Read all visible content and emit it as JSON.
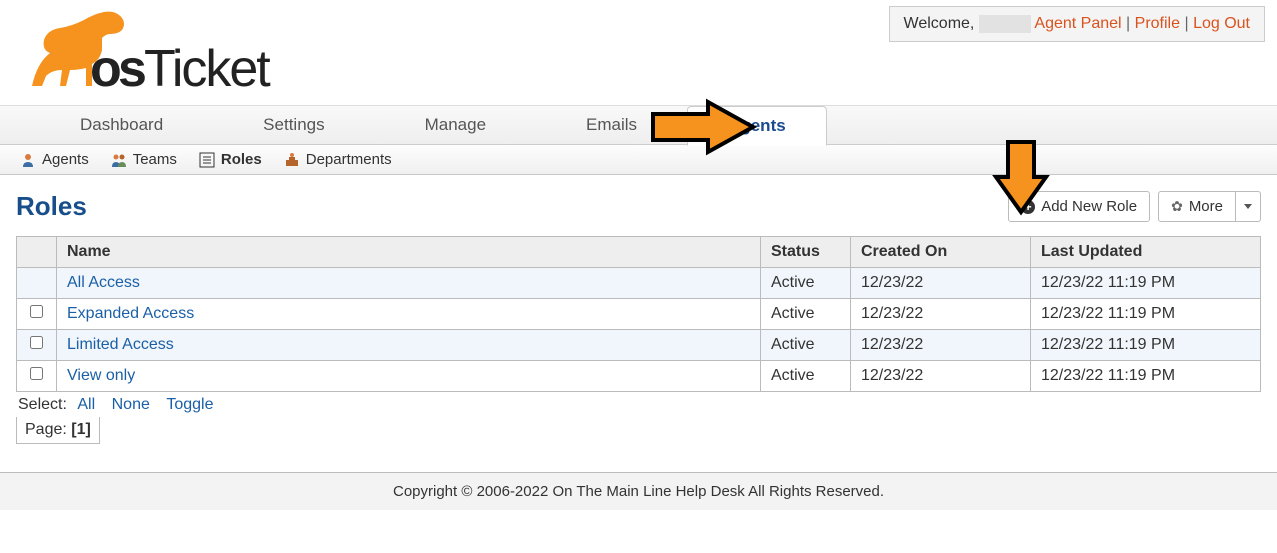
{
  "header": {
    "welcome": "Welcome,",
    "links": {
      "agent_panel": "Agent Panel",
      "profile": "Profile",
      "logout": "Log Out"
    }
  },
  "main_nav": {
    "items": [
      "Dashboard",
      "Settings",
      "Manage",
      "Emails",
      "Agents"
    ],
    "active_index": 4
  },
  "sub_nav": {
    "items": [
      {
        "label": "Agents",
        "icon": "agent-icon"
      },
      {
        "label": "Teams",
        "icon": "team-icon"
      },
      {
        "label": "Roles",
        "icon": "list-icon"
      },
      {
        "label": "Departments",
        "icon": "dept-icon"
      }
    ],
    "active_index": 2
  },
  "page": {
    "title": "Roles",
    "add_btn": "Add New Role",
    "more_btn": "More"
  },
  "table": {
    "headers": [
      "",
      "Name",
      "Status",
      "Created On",
      "Last Updated"
    ],
    "rows": [
      {
        "name": "All Access",
        "status": "Active",
        "created": "12/23/22",
        "updated": "12/23/22 11:19 PM",
        "checkbox": false
      },
      {
        "name": "Expanded Access",
        "status": "Active",
        "created": "12/23/22",
        "updated": "12/23/22 11:19 PM",
        "checkbox": true
      },
      {
        "name": "Limited Access",
        "status": "Active",
        "created": "12/23/22",
        "updated": "12/23/22 11:19 PM",
        "checkbox": true
      },
      {
        "name": "View only",
        "status": "Active",
        "created": "12/23/22",
        "updated": "12/23/22 11:19 PM",
        "checkbox": true
      }
    ]
  },
  "select_bar": {
    "label": "Select:",
    "all": "All",
    "none": "None",
    "toggle": "Toggle"
  },
  "page_bar": {
    "label": "Page:",
    "current": "[1]"
  },
  "footer": "Copyright © 2006-2022 On The Main Line Help Desk All Rights Reserved."
}
